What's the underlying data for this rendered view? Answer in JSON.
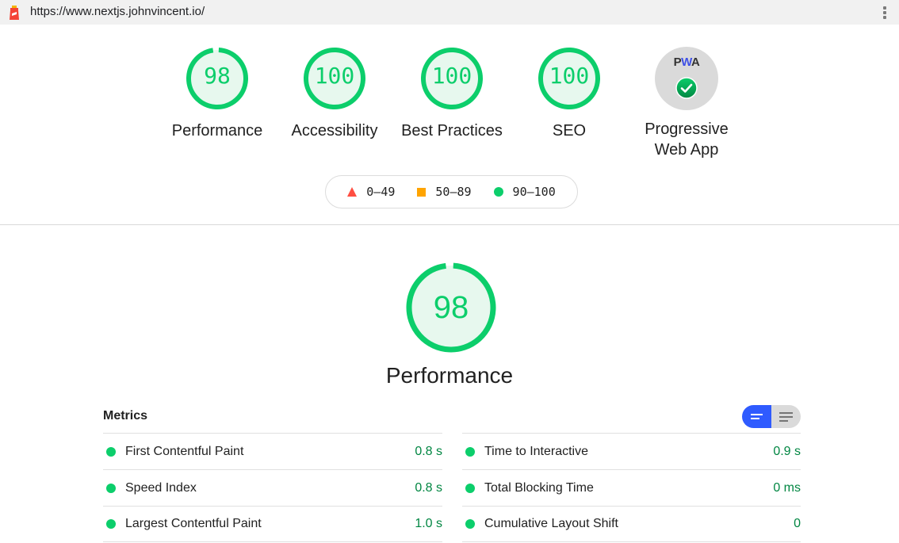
{
  "header": {
    "url": "https://www.nextjs.johnvincent.io/",
    "logo_icon": "lighthouse-icon",
    "menu_icon": "kebab-menu-icon"
  },
  "colors": {
    "pass": "#0cce6b",
    "average": "#ffa400",
    "fail": "#ff4e42",
    "pass_text": "#018642",
    "toggle_active": "#2f5bff"
  },
  "categories": [
    {
      "label": "Performance",
      "score": "98",
      "fraction": 0.98
    },
    {
      "label": "Accessibility",
      "score": "100",
      "fraction": 1.0
    },
    {
      "label": "Best Practices",
      "score": "100",
      "fraction": 1.0
    },
    {
      "label": "SEO",
      "score": "100",
      "fraction": 1.0
    }
  ],
  "pwa": {
    "badge_text_p": "P",
    "badge_text_w": "W",
    "badge_text_a": "A",
    "label_line1": "Progressive",
    "label_line2": "Web App",
    "status_icon": "check-circle-icon"
  },
  "legend": [
    {
      "shape": "triangle",
      "range": "0–49"
    },
    {
      "shape": "square",
      "range": "50–89"
    },
    {
      "shape": "circle",
      "range": "90–100"
    }
  ],
  "performance": {
    "score": "98",
    "fraction": 0.98,
    "title": "Performance"
  },
  "metrics": {
    "title": "Metrics",
    "view_toggle": {
      "active": "compact-view",
      "inactive": "expanded-view"
    },
    "left": [
      {
        "label": "First Contentful Paint",
        "value": "0.8 s"
      },
      {
        "label": "Speed Index",
        "value": "0.8 s"
      },
      {
        "label": "Largest Contentful Paint",
        "value": "1.0 s"
      }
    ],
    "right": [
      {
        "label": "Time to Interactive",
        "value": "0.9 s"
      },
      {
        "label": "Total Blocking Time",
        "value": "0 ms"
      },
      {
        "label": "Cumulative Layout Shift",
        "value": "0"
      }
    ]
  }
}
